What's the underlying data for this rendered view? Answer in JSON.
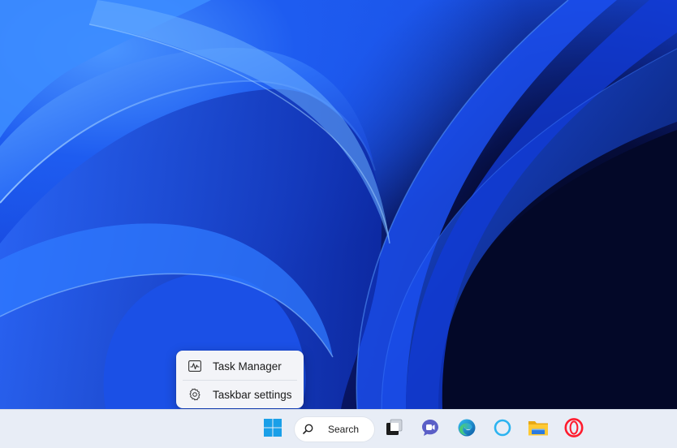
{
  "context_menu": {
    "items": [
      {
        "label": "Task Manager",
        "icon": "task-manager-icon"
      },
      {
        "label": "Taskbar settings",
        "icon": "gear-icon"
      }
    ]
  },
  "taskbar": {
    "search_label": "Search",
    "apps": [
      {
        "name": "start",
        "icon": "windows-logo-icon"
      },
      {
        "name": "task-view",
        "icon": "task-view-icon"
      },
      {
        "name": "teams-chat",
        "icon": "teams-chat-icon"
      },
      {
        "name": "edge",
        "icon": "edge-icon"
      },
      {
        "name": "cortana",
        "icon": "cortana-icon"
      },
      {
        "name": "file-explorer",
        "icon": "folder-icon"
      },
      {
        "name": "opera",
        "icon": "opera-icon"
      }
    ]
  },
  "colors": {
    "taskbar_bg": "#e8edf6",
    "menu_bg": "#f3f4f8",
    "windows_blue": "#1a9fe8",
    "teams_purple": "#5b5fc7",
    "opera_red": "#ff1b2d"
  }
}
